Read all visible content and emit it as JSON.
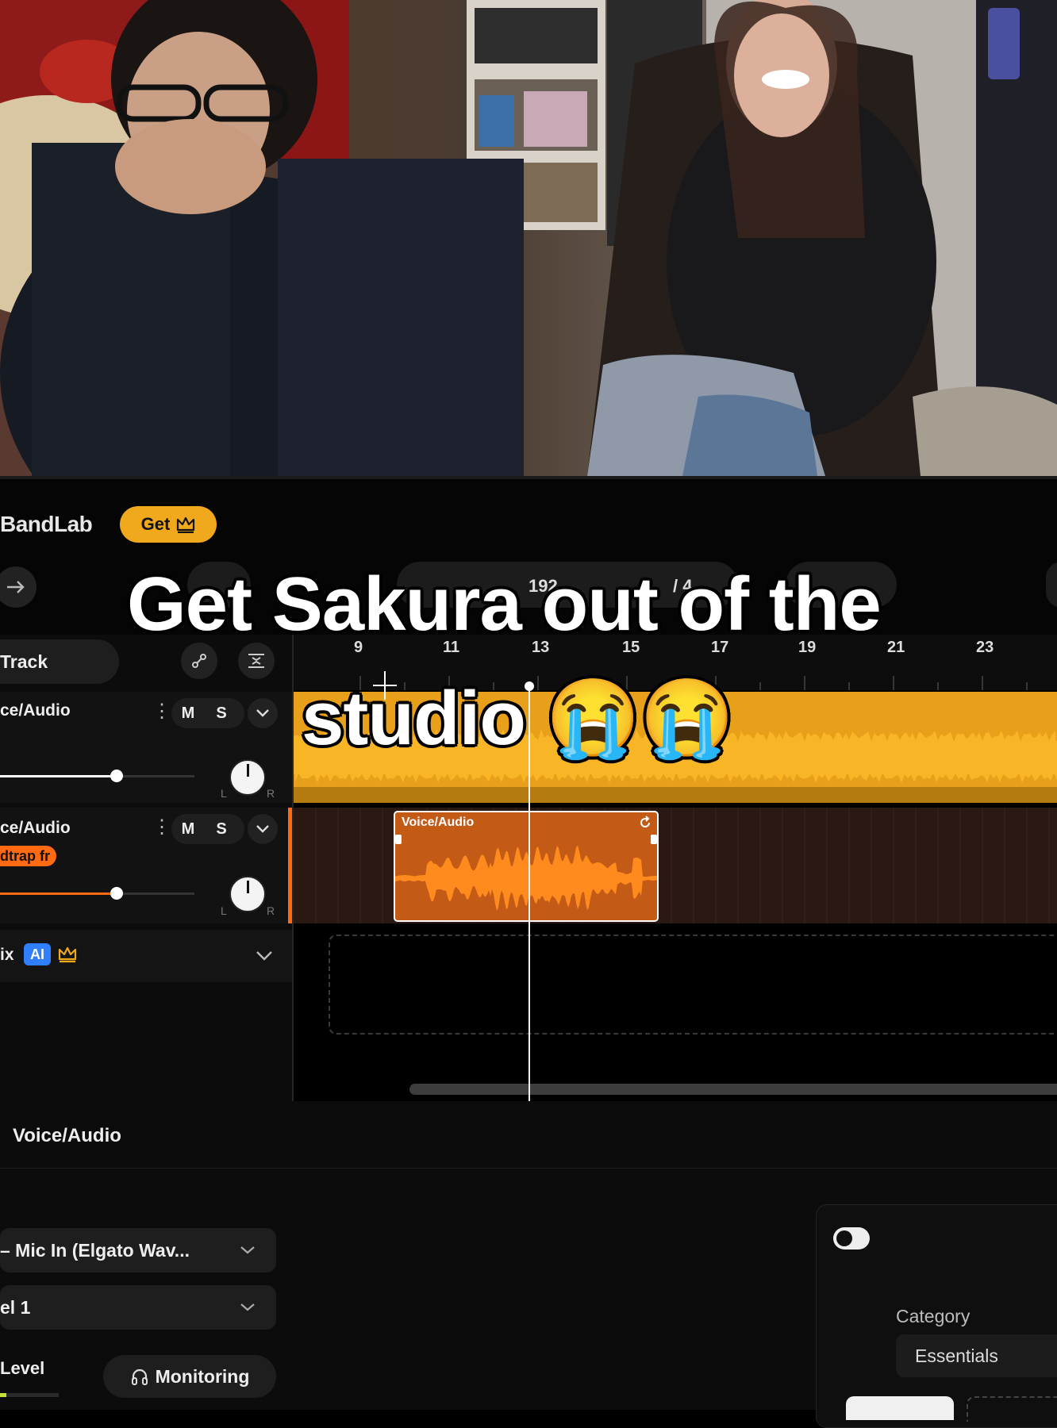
{
  "caption": {
    "line1": "Get Sakura out of the",
    "line2": "studio 😭😭"
  },
  "app": {
    "brand": "BandLab",
    "get_button": "Get",
    "toolbar": {
      "tempo_partial": "192",
      "signature_partial": "/ 4"
    },
    "add_track_label": "Track",
    "ruler_ticks": [
      "9",
      "11",
      "13",
      "15",
      "17",
      "19",
      "21",
      "23"
    ]
  },
  "tracks": [
    {
      "name": "ce/Audio",
      "mute": "M",
      "solo": "S",
      "knob_left": "L",
      "knob_right": "R"
    },
    {
      "name": "ce/Audio",
      "tag": "dtrap fr",
      "mute": "M",
      "solo": "S",
      "knob_left": "L",
      "knob_right": "R"
    },
    {
      "name": "ix",
      "ai_badge": "AI"
    }
  ],
  "region": {
    "label": "Voice/Audio"
  },
  "editor": {
    "title": "Voice/Audio",
    "input_select": "– Mic In (Elgato Wav...",
    "channel_select": "el 1",
    "level_label": "Level",
    "monitoring_button": "Monitoring"
  },
  "effects": {
    "category_label": "Category",
    "category_value": "Essentials"
  },
  "colors": {
    "accent_gold": "#f0a81c",
    "track1_wave": "#f5a623",
    "track2_orange": "#ff7a1a",
    "ai_blue": "#2f7fff"
  }
}
